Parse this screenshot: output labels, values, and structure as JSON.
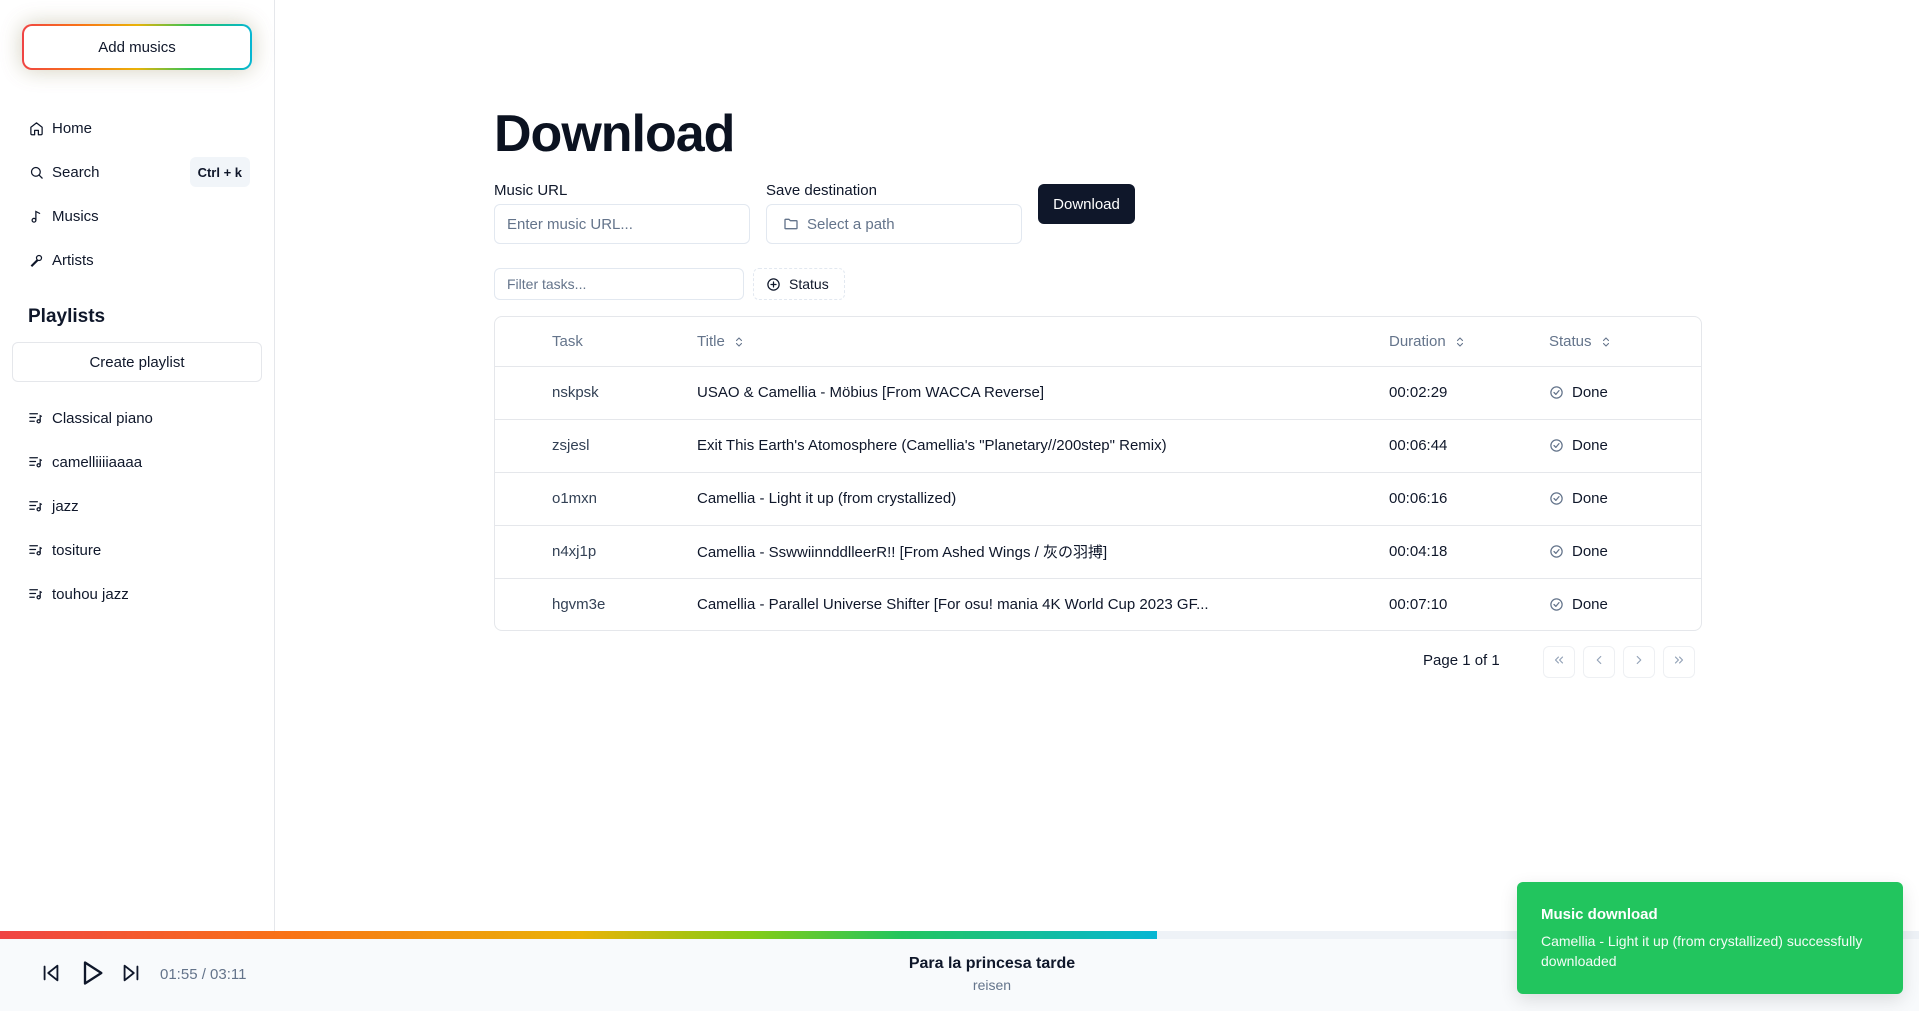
{
  "sidebar": {
    "add_button": "Add musics",
    "nav": [
      {
        "label": "Home",
        "icon": "home-icon"
      },
      {
        "label": "Search",
        "icon": "search-icon",
        "shortcut": "Ctrl + k"
      },
      {
        "label": "Musics",
        "icon": "music-note-icon"
      },
      {
        "label": "Artists",
        "icon": "microphone-icon"
      }
    ],
    "playlists_title": "Playlists",
    "create_playlist": "Create playlist",
    "playlists": [
      {
        "label": "Classical piano"
      },
      {
        "label": "camelliiiiaaaa"
      },
      {
        "label": "jazz"
      },
      {
        "label": "tositure"
      },
      {
        "label": "touhou jazz"
      }
    ]
  },
  "main": {
    "title": "Download",
    "music_url_label": "Music URL",
    "music_url_placeholder": "Enter music URL...",
    "music_url_value": "",
    "save_dest_label": "Save destination",
    "save_dest_placeholder": "Select a path",
    "download_button": "Download",
    "filter_placeholder": "Filter tasks...",
    "status_filter": "Status"
  },
  "table": {
    "headers": {
      "task": "Task",
      "title": "Title",
      "duration": "Duration",
      "status": "Status"
    },
    "rows": [
      {
        "task": "nskpsk",
        "title": "USAO & Camellia - Möbius [From WACCA Reverse]",
        "duration": "00:02:29",
        "status": "Done"
      },
      {
        "task": "zsjesl",
        "title": "Exit This Earth's Atomosphere (Camellia's \"Planetary//200step\" Remix)",
        "duration": "00:06:44",
        "status": "Done"
      },
      {
        "task": "o1mxn",
        "title": "Camellia - Light it up (from crystallized)",
        "duration": "00:06:16",
        "status": "Done"
      },
      {
        "task": "n4xj1p",
        "title": "Camellia - SswwiinnddlleerR!! [From Ashed Wings / 灰の羽搏]",
        "duration": "00:04:18",
        "status": "Done"
      },
      {
        "task": "hgvm3e",
        "title": "Camellia - Parallel Universe Shifter [For osu! mania 4K World Cup 2023 GF...",
        "duration": "00:07:10",
        "status": "Done"
      }
    ]
  },
  "pagination": {
    "label": "Page 1 of 1"
  },
  "player": {
    "time": "01:55 / 03:11",
    "progress": 0.603,
    "title": "Para la princesa tarde",
    "artist": "reisen"
  },
  "toast": {
    "title": "Music download",
    "message": "Camellia - Light it up (from crystallized) successfully downloaded",
    "color": "#22c55e"
  }
}
